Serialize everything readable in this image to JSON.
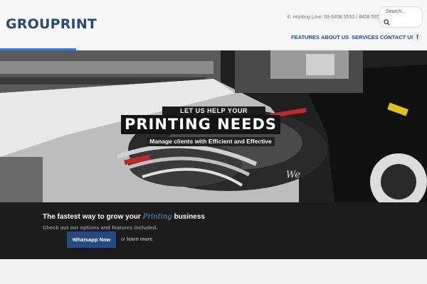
{
  "header": {
    "logo": "GROUPRINT",
    "hotline": "Hunting Line: 03-8408 5550 / 8408 5551",
    "search_placeholder": "Search...",
    "nav": [
      "FEATURES",
      "ABOUT US",
      "SERVICES",
      "CONTACT US"
    ],
    "facebook_label": "f"
  },
  "hero": {
    "tagline_top": "LET US HELP YOUR",
    "headline": "PRINTING NEEDS",
    "subline": "Manage clients with Efficient and Effective",
    "overlay_word": "We"
  },
  "cta": {
    "title_pre": "The fastest way to grow your ",
    "title_accent": "Printing",
    "title_post": " business",
    "subtitle": "Check out our options and features included.",
    "button_label": "Whatsapp Now",
    "or_text": "or ",
    "learn_more": "learn more",
    "learn_more_suffix": "."
  },
  "colors": {
    "brand": "#26497f",
    "accent": "#3a7bd5",
    "cta_bg": "#1c1c1c"
  }
}
